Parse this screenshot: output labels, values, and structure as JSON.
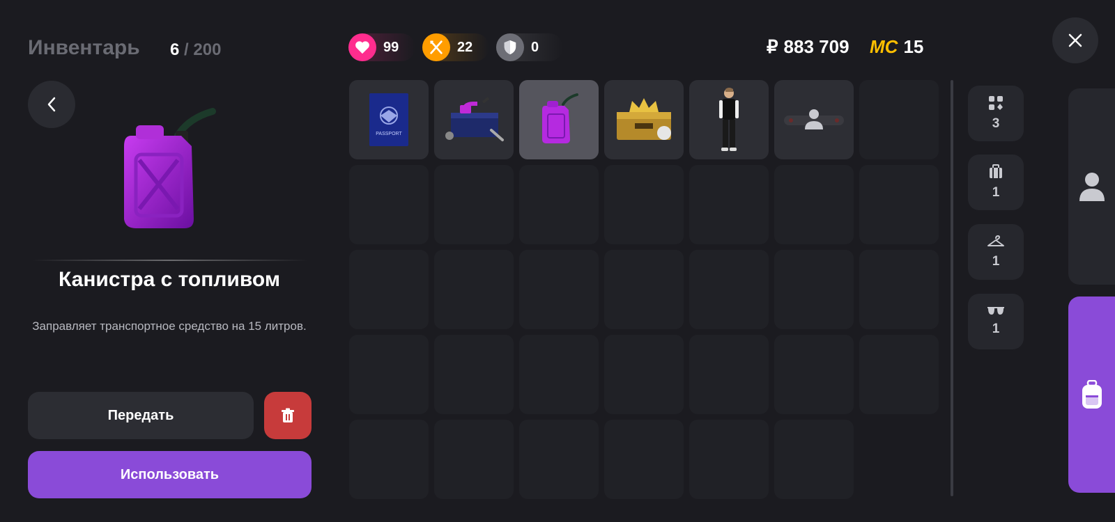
{
  "header": {
    "title": "Инвентарь",
    "count_current": "6",
    "count_separator": "/",
    "count_max": "200"
  },
  "stats": {
    "health": "99",
    "food": "22",
    "armor": "0"
  },
  "currency": {
    "rub_symbol": "₽",
    "rub_amount": "883 709",
    "mc_label": "MC",
    "mc_amount": "15"
  },
  "selected_item": {
    "name": "Канистра с топливом",
    "description": "Заправляет транспортное средство на 15 литров."
  },
  "actions": {
    "transfer_label": "Передать",
    "use_label": "Использовать"
  },
  "inventory": {
    "slot_items": [
      "passport",
      "toolbox",
      "fuel-canister",
      "crown-chest",
      "character-skin",
      "accessory"
    ],
    "selected_index": 2,
    "passport_text": "PASSPORT"
  },
  "categories": [
    {
      "icon": "grid-icon",
      "count": "3"
    },
    {
      "icon": "luggage-icon",
      "count": "1"
    },
    {
      "icon": "hanger-icon",
      "count": "1"
    },
    {
      "icon": "sunglasses-icon",
      "count": "1"
    }
  ],
  "colors": {
    "accent_purple": "#8a4bd8",
    "health_pink": "#ff2d8e",
    "food_orange": "#ff9d00",
    "delete_red": "#c73b3b",
    "mc_gold": "#ffbf00"
  }
}
